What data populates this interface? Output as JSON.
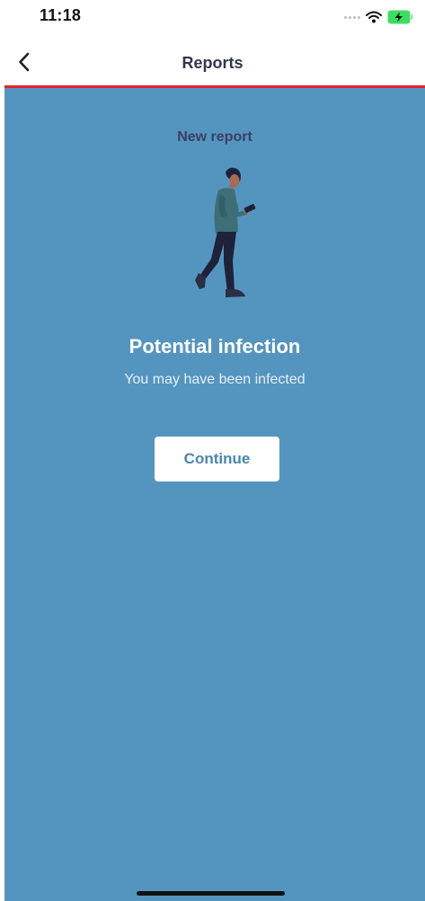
{
  "status_bar": {
    "time": "11:18",
    "signal_icon": "signal-dots-icon",
    "wifi_icon": "wifi-icon",
    "battery_icon": "battery-charging-icon",
    "battery_color": "#3ddc63"
  },
  "nav": {
    "title": "Reports",
    "back_icon": "chevron-left-icon",
    "divider_color": "#e0242f"
  },
  "main": {
    "background_color": "#5495bf",
    "section_title": "New report",
    "illustration": "person-walking-reading-phone",
    "headline": "Potential infection",
    "subhead": "You may have been infected",
    "continue_label": "Continue"
  }
}
